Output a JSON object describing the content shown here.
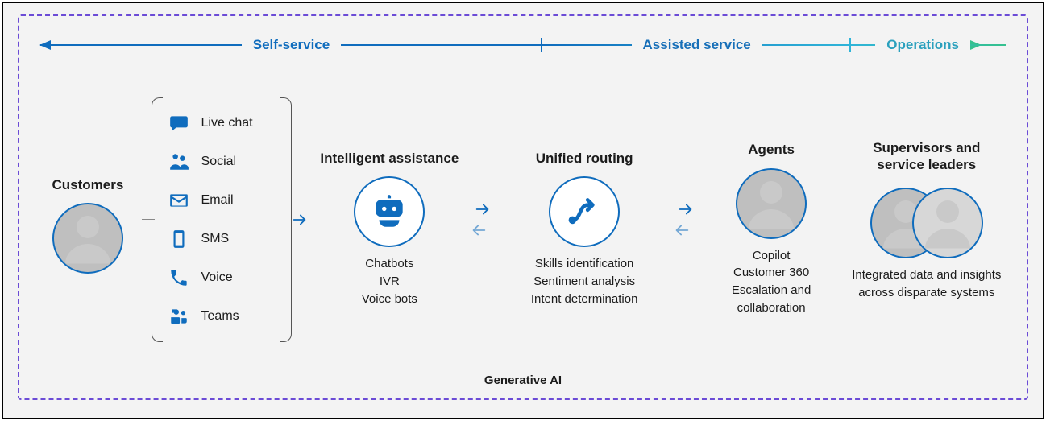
{
  "timeline": {
    "self_service": "Self-service",
    "assisted": "Assisted service",
    "operations": "Operations"
  },
  "customers": {
    "title": "Customers"
  },
  "channels": [
    {
      "icon": "chat-icon",
      "label": "Live chat"
    },
    {
      "icon": "social-icon",
      "label": "Social"
    },
    {
      "icon": "email-icon",
      "label": "Email"
    },
    {
      "icon": "sms-icon",
      "label": "SMS"
    },
    {
      "icon": "voice-icon",
      "label": "Voice"
    },
    {
      "icon": "teams-icon",
      "label": "Teams"
    }
  ],
  "intelligent": {
    "title": "Intelligent assistance",
    "items": [
      "Chatbots",
      "IVR",
      "Voice bots"
    ]
  },
  "routing": {
    "title": "Unified routing",
    "items": [
      "Skills identification",
      "Sentiment analysis",
      "Intent determination"
    ]
  },
  "agents": {
    "title": "Agents",
    "items": [
      "Copilot",
      "Customer 360",
      "Escalation and collaboration"
    ]
  },
  "supervisors": {
    "title": "Supervisors and service leaders",
    "desc": "Integrated data and insights across disparate systems"
  },
  "footer": "Generative AI",
  "colors": {
    "brand_blue": "#0f6cbd",
    "cyan": "#2fb4d8",
    "green": "#35c18f",
    "dashed_border": "#6b4bd6"
  }
}
